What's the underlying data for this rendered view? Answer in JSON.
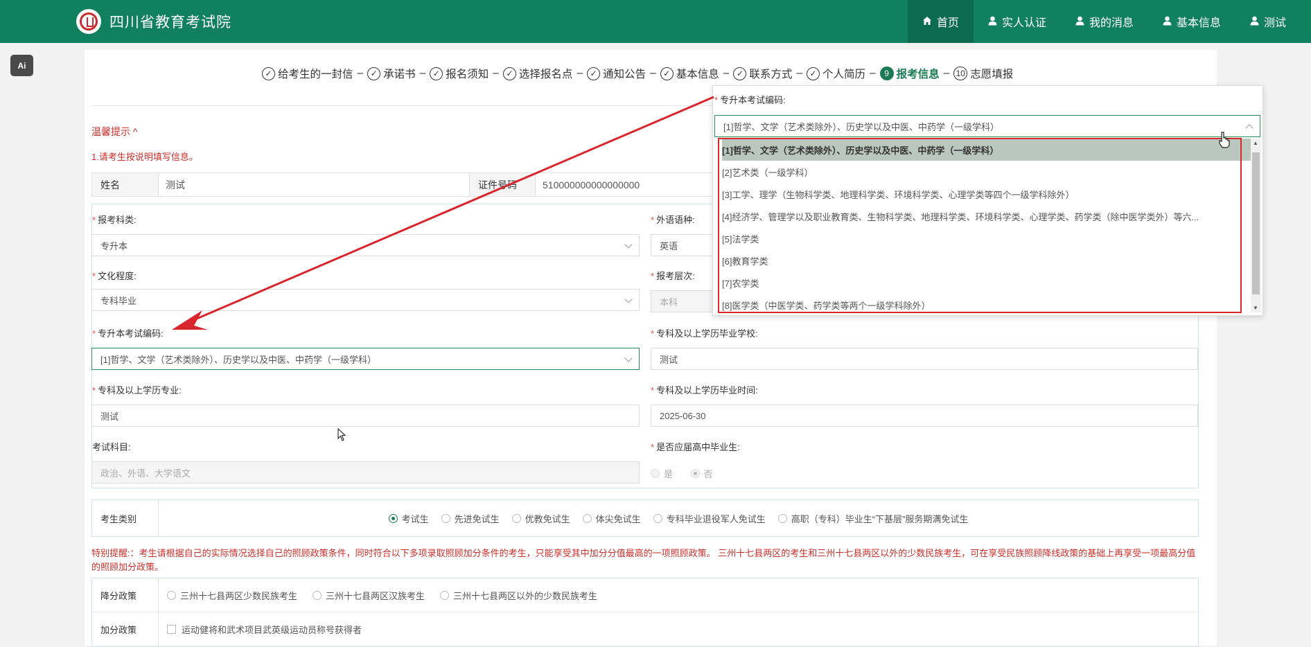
{
  "header": {
    "site_title": "四川省教育考试院",
    "nav": [
      {
        "label": "首页",
        "icon": "home-icon",
        "active": true
      },
      {
        "label": "实人认证",
        "icon": "user-icon",
        "active": false
      },
      {
        "label": "我的消息",
        "icon": "user-icon",
        "active": false
      },
      {
        "label": "基本信息",
        "icon": "user-icon",
        "active": false
      },
      {
        "label": "测试",
        "icon": "user-icon",
        "active": false
      }
    ],
    "colors": {
      "bar": "#11805f",
      "active": "#0c6b4f"
    }
  },
  "ai_badge": "Ai",
  "steps": [
    {
      "label": "给考生的一封信",
      "marker": "✓",
      "state": "done"
    },
    {
      "label": "承诺书",
      "marker": "✓",
      "state": "done"
    },
    {
      "label": "报名须知",
      "marker": "✓",
      "state": "done"
    },
    {
      "label": "选择报名点",
      "marker": "✓",
      "state": "done"
    },
    {
      "label": "通知公告",
      "marker": "✓",
      "state": "done"
    },
    {
      "label": "基本信息",
      "marker": "✓",
      "state": "done"
    },
    {
      "label": "联系方式",
      "marker": "✓",
      "state": "done"
    },
    {
      "label": "个人简历",
      "marker": "✓",
      "state": "done"
    },
    {
      "label": "报考信息",
      "marker": "9",
      "state": "current"
    },
    {
      "label": "志愿填报",
      "marker": "10",
      "state": "todo"
    }
  ],
  "tips": {
    "title": "温馨提示 ^",
    "line1": "1.请考生按说明填写信息。"
  },
  "identity": {
    "name_label": "姓名",
    "name_value": "测试",
    "id_label": "证件号码",
    "id_value": "510000000000000000"
  },
  "form": {
    "subject_type": {
      "label": "报考科类:",
      "value": "专升本"
    },
    "foreign_lang": {
      "label": "外语语种:",
      "value": "英语"
    },
    "education": {
      "label": "文化程度:",
      "value": "专科毕业"
    },
    "level": {
      "label": "报考层次:",
      "value": "本科"
    },
    "exam_code": {
      "label": "专升本考试编码:",
      "value": "[1]哲学、文学（艺术类除外）、历史学以及中医、中药学（一级学科）"
    },
    "grad_school": {
      "label": "专科及以上学历毕业学校:",
      "value": "测试"
    },
    "major": {
      "label": "专科及以上学历专业:",
      "value": "测试"
    },
    "grad_time": {
      "label": "专科及以上学历毕业时间:",
      "value": "2025-06-30"
    },
    "exam_subjects": {
      "label": "考试科目:",
      "value": "政治、外语、大学语文"
    },
    "fresh_grad": {
      "label": "是否应届高中毕业生:",
      "options": [
        "是",
        "否"
      ],
      "selected": "否"
    }
  },
  "candidate_type": {
    "label": "考生类别",
    "options": [
      "考试生",
      "先进免试生",
      "优教免试生",
      "体尖免试生",
      "专科毕业退役军人免试生",
      "高职（专科）毕业生“下基层”服务期满免试生"
    ],
    "selected": "考试生"
  },
  "notice": "特别提醒:：考生请根据自己的实际情况选择自己的照顾政策条件，同时符合以下多项录取照顾加分条件的考生，只能享受其中加分分值最高的一项照顾政策。 三州十七县两区的考生和三州十七县两区以外的少数民族考生，可在享受民族照顾降线政策的基础上再享受一项最高分值的照顾加分政策。",
  "policy": {
    "reduce_label": "降分政策",
    "reduce_options": [
      "三州十七县两区少数民族考生",
      "三州十七县两区汉族考生",
      "三州十七县两区以外的少数民族考生"
    ],
    "bonus_label": "加分政策",
    "bonus_options": [
      "运动健将和武术项目武英级运动员称号获得者"
    ]
  },
  "popup": {
    "label": "专升本考试编码:",
    "value": "[1]哲学、文学（艺术类除外）、历史学以及中医、中药学（一级学科）",
    "options": [
      "[1]哲学、文学（艺术类除外）、历史学以及中医、中药学（一级学科）",
      "[2]艺术类（一级学科）",
      "[3]工学、理学（生物科学类、地理科学类、环境科学类、心理学类等四个一级学科除外）",
      "[4]经济学、管理学以及职业教育类、生物科学类、地理科学类、环境科学类、心理学类、药学类（除中医学类外）等六...",
      "[5]法学类",
      "[6]教育学类",
      "[7]农学类",
      "[8]医学类（中医学类、药学类等两个一级学科除外）"
    ],
    "selected_index": 0
  },
  "annotation_color": "#d9262c"
}
